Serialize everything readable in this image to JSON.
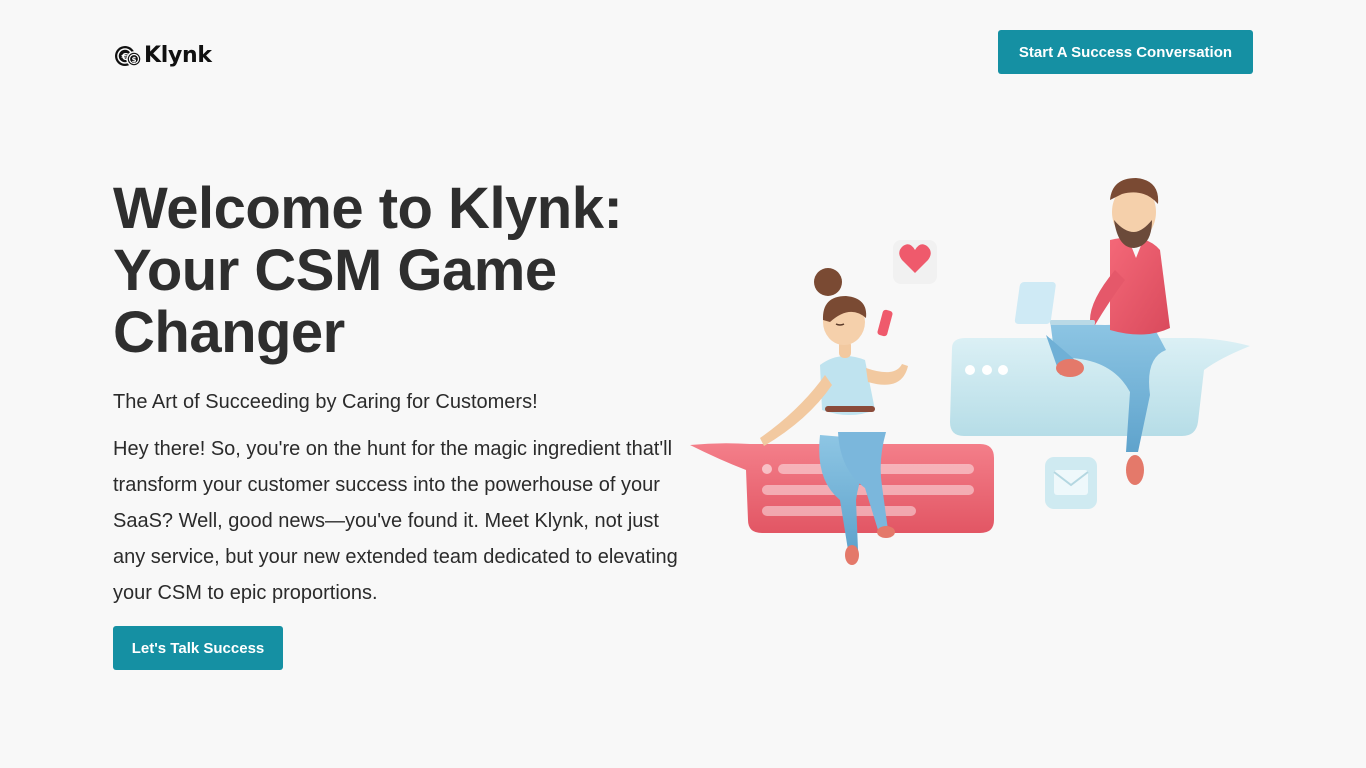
{
  "header": {
    "logo": {
      "text": "Klynk",
      "icon": "coins-logo-icon"
    },
    "cta_label": "Start A Success Conversation"
  },
  "hero": {
    "title_lines": [
      "Welcome to Klynk:",
      "Your CSM Game",
      "Changer"
    ],
    "tagline": "The Art of Succeeding by Caring for Customers!",
    "intro": "Hey there! So, you're on the hunt for the magic ingredient that'll transform your customer success into the powerhouse of your SaaS? Well, good news—you've found it. Meet Klynk, not just any service, but your new extended team dedicated to elevating your CSM to epic proportions.",
    "cta_label": "Let's Talk Success"
  },
  "illustration": {
    "icon": "chat-people-illustration",
    "elements": [
      "heart-icon",
      "mail-icon",
      "laptop-icon",
      "phone-icon"
    ]
  },
  "colors": {
    "background": "#f8f8f8",
    "accent": "#1590a3",
    "heading": "#2e2e2e",
    "text": "#2b2b2b"
  }
}
